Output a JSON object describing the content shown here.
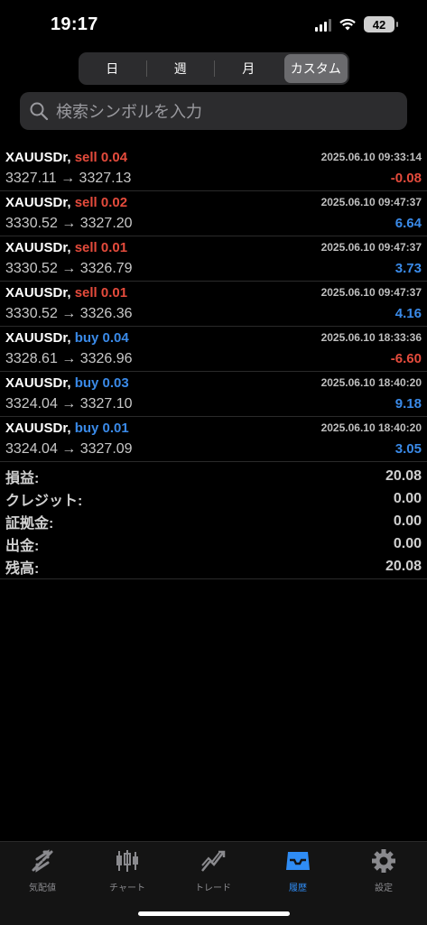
{
  "status_bar": {
    "time": "19:17",
    "battery": "42"
  },
  "segmented": {
    "options": [
      "日",
      "週",
      "月",
      "カスタム"
    ],
    "selected": "カスタム"
  },
  "search": {
    "placeholder": "検索シンボルを入力"
  },
  "trades": [
    {
      "symbol": "XAUUSDr,",
      "side": "sell",
      "volume": "0.04",
      "datetime": "2025.06.10 09:33:14",
      "prices": "3327.11 → 3327.13",
      "profit": "-0.08"
    },
    {
      "symbol": "XAUUSDr,",
      "side": "sell",
      "volume": "0.02",
      "datetime": "2025.06.10 09:47:37",
      "prices": "3330.52 → 3327.20",
      "profit": "6.64"
    },
    {
      "symbol": "XAUUSDr,",
      "side": "sell",
      "volume": "0.01",
      "datetime": "2025.06.10 09:47:37",
      "prices": "3330.52 → 3326.79",
      "profit": "3.73"
    },
    {
      "symbol": "XAUUSDr,",
      "side": "sell",
      "volume": "0.01",
      "datetime": "2025.06.10 09:47:37",
      "prices": "3330.52 → 3326.36",
      "profit": "4.16"
    },
    {
      "symbol": "XAUUSDr,",
      "side": "buy",
      "volume": "0.04",
      "datetime": "2025.06.10 18:33:36",
      "prices": "3328.61 → 3326.96",
      "profit": "-6.60"
    },
    {
      "symbol": "XAUUSDr,",
      "side": "buy",
      "volume": "0.03",
      "datetime": "2025.06.10 18:40:20",
      "prices": "3324.04 → 3327.10",
      "profit": "9.18"
    },
    {
      "symbol": "XAUUSDr,",
      "side": "buy",
      "volume": "0.01",
      "datetime": "2025.06.10 18:40:20",
      "prices": "3324.04 → 3327.09",
      "profit": "3.05"
    }
  ],
  "summary": [
    {
      "label": "損益:",
      "value": "20.08"
    },
    {
      "label": "クレジット:",
      "value": "0.00"
    },
    {
      "label": "証拠金:",
      "value": "0.00"
    },
    {
      "label": "出金:",
      "value": "0.00"
    },
    {
      "label": "残高:",
      "value": "20.08"
    }
  ],
  "tabs": [
    {
      "label": "気配値",
      "icon": "quotes-icon"
    },
    {
      "label": "チャート",
      "icon": "chart-icon"
    },
    {
      "label": "トレード",
      "icon": "trade-icon"
    },
    {
      "label": "履歴",
      "icon": "history-icon",
      "active": true
    },
    {
      "label": "設定",
      "icon": "gear-icon"
    }
  ],
  "colors": {
    "sell": "#e44b3c",
    "buy": "#3a8ae8",
    "active_tab": "#2f8cf4"
  }
}
